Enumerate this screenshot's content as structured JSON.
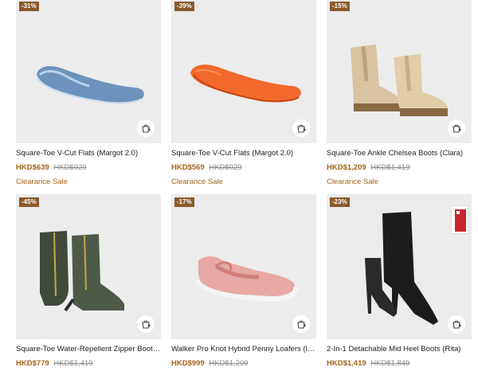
{
  "products": [
    {
      "discount": "-31%",
      "name": "Square-Toe V-Cut Flats (Margot 2.0)",
      "price": "HKD$639",
      "original_price": "HKD$929",
      "tag": "Clearance Sale",
      "color": "#7fa3c9"
    },
    {
      "discount": "-39%",
      "name": "Square-Toe V-Cut Flats (Margot 2.0)",
      "price": "HKD$569",
      "original_price": "HKD$929",
      "tag": "Clearance Sale",
      "color": "#f2692c"
    },
    {
      "discount": "-15%",
      "name": "Square-Toe Ankle Chelsea Boots (Clara)",
      "price": "HKD$1,209",
      "original_price": "HKD$1,419",
      "tag": "Clearance Sale",
      "color": "#d9c3a1"
    },
    {
      "discount": "-45%",
      "name": "Square-Toe Water-Repellent Zipper Boots...",
      "price": "HKD$779",
      "original_price": "HKD$1,419",
      "tag": "",
      "color": "#485444"
    },
    {
      "discount": "-17%",
      "name": "Walker Pro Knot Hybrid Penny Loafers (la...",
      "price": "HKD$999",
      "original_price": "HKD$1,209",
      "tag": "",
      "color": "#e7a9a4"
    },
    {
      "discount": "-23%",
      "name": "2-In-1 Detachable Mid Heel Boots (Rita)",
      "price": "HKD$1,419",
      "original_price": "HKD$1,849",
      "tag": "",
      "color": "#1c1c1c"
    }
  ],
  "icons": {
    "cart": "add-to-cart-icon"
  }
}
